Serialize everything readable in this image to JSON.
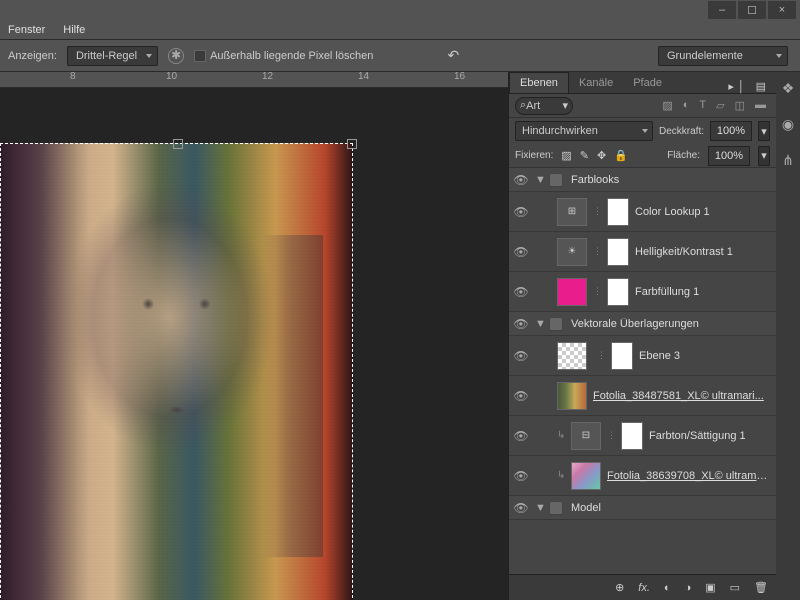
{
  "menu": {
    "fenster": "Fenster",
    "hilfe": "Hilfe"
  },
  "window": {
    "min": "–",
    "max": "☐",
    "close": "×"
  },
  "options": {
    "anzeigen": "Anzeigen:",
    "rule": "Drittel-Regel",
    "checkbox_label": "Außerhalb liegende Pixel löschen",
    "workspace": "Grundelemente"
  },
  "ruler": {
    "ticks": [
      "8",
      "10",
      "12",
      "14",
      "16"
    ]
  },
  "panel": {
    "tabs": {
      "ebenen": "Ebenen",
      "kanale": "Kanäle",
      "pfade": "Pfade"
    },
    "search": "Art",
    "blend": "Hindurchwirken",
    "opacity_label": "Deckkraft:",
    "opacity": "100%",
    "fill_label": "Fläche:",
    "fill": "100%",
    "lock_label": "Fixieren:"
  },
  "layers": [
    {
      "type": "group",
      "name": "Farblooks"
    },
    {
      "type": "adj",
      "name": "Color Lookup 1",
      "icon": "⊞"
    },
    {
      "type": "adj",
      "name": "Helligkeit/Kontrast 1",
      "icon": "☀"
    },
    {
      "type": "fill",
      "name": "Farbfüllung 1"
    },
    {
      "type": "group",
      "name": "Vektorale Überlagerungen"
    },
    {
      "type": "layer",
      "name": "Ebene 3",
      "thumb": "chk"
    },
    {
      "type": "layer",
      "name": "Fotolia_38487581_XL© ultramari...",
      "thumb": "img1",
      "underline": true
    },
    {
      "type": "adj",
      "name": "Farbton/Sättigung 1",
      "icon": "⊟",
      "clip": true
    },
    {
      "type": "layer",
      "name": "Fotolia_38639708_XL© ultramari...",
      "thumb": "img2",
      "underline": true,
      "clip": true
    },
    {
      "type": "group",
      "name": "Model"
    }
  ],
  "footer_icons": [
    "⊕",
    "fx.",
    "◐",
    "◑",
    "▣",
    "▭",
    "🗑"
  ]
}
